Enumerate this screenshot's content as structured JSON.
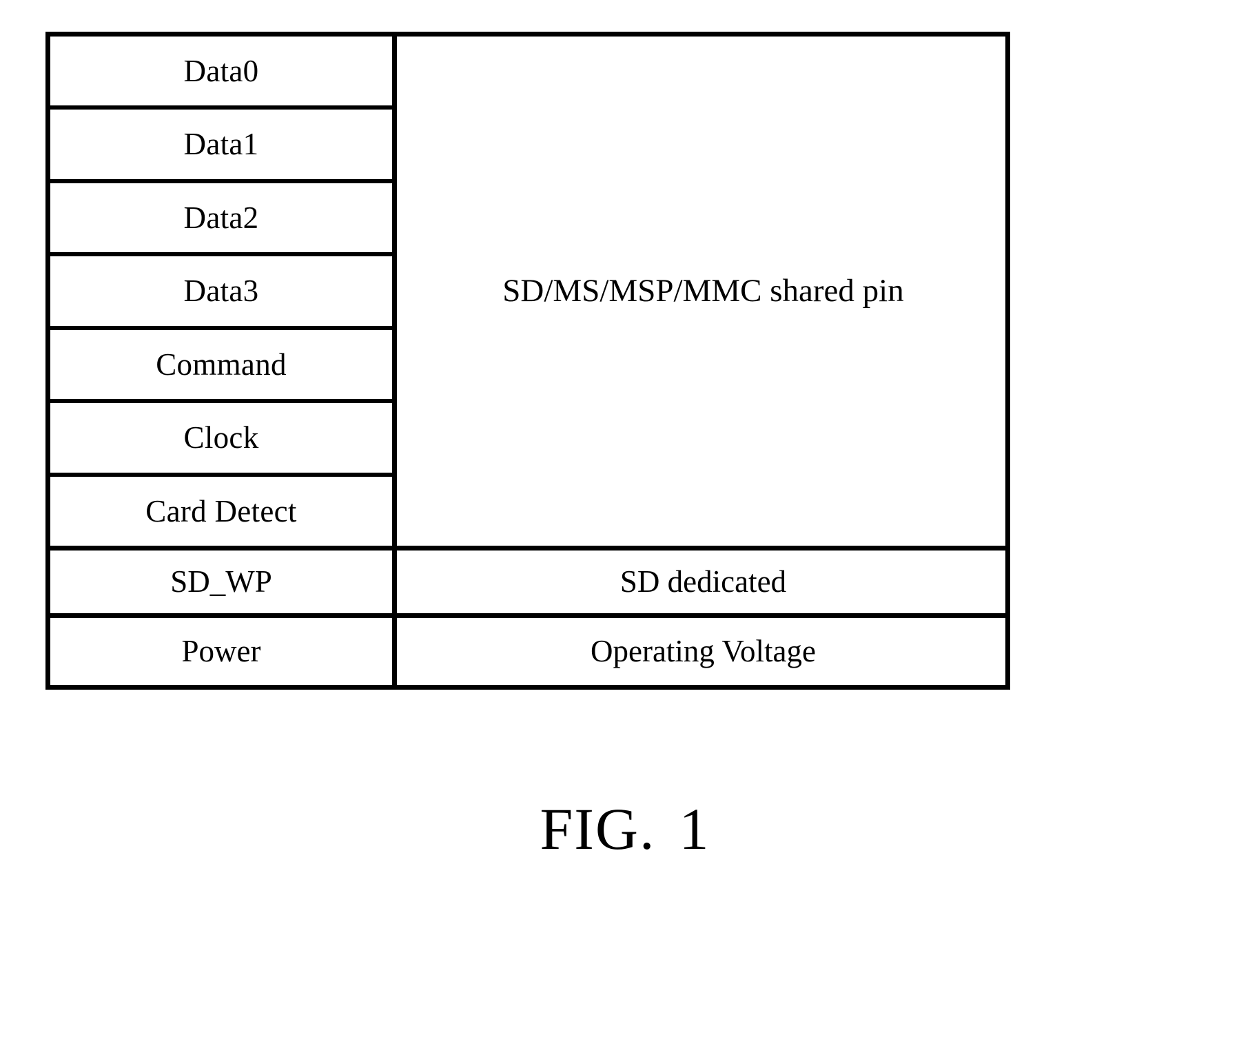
{
  "figure": {
    "caption_label": "FIG.",
    "caption_number": "1"
  },
  "table": {
    "shared_rows": [
      {
        "pin": "Data0"
      },
      {
        "pin": "Data1"
      },
      {
        "pin": "Data2"
      },
      {
        "pin": "Data3"
      },
      {
        "pin": "Command"
      },
      {
        "pin": "Clock"
      },
      {
        "pin": "Card Detect"
      }
    ],
    "shared_description": "SD/MS/MSP/MMC shared pin",
    "other_rows": [
      {
        "pin": "SD_WP",
        "description": "SD dedicated"
      },
      {
        "pin": "Power",
        "description": "Operating Voltage"
      }
    ]
  },
  "style": {
    "line_color": "#000000",
    "background_color": "#ffffff",
    "text_color": "#000000"
  }
}
